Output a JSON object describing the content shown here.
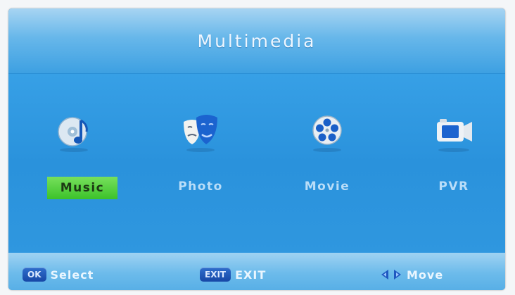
{
  "header": {
    "title": "Multimedia"
  },
  "menu": {
    "items": [
      {
        "label": "Music",
        "icon": "music-disc-icon",
        "selected": true
      },
      {
        "label": "Photo",
        "icon": "photo-masks-icon",
        "selected": false
      },
      {
        "label": "Movie",
        "icon": "movie-reel-icon",
        "selected": false
      },
      {
        "label": "PVR",
        "icon": "pvr-camera-icon",
        "selected": false
      }
    ]
  },
  "footer": {
    "select": {
      "key": "OK",
      "label": "Select"
    },
    "exit": {
      "key": "EXIT",
      "label": "EXIT"
    },
    "move": {
      "label": "Move"
    }
  },
  "colors": {
    "background": "#2f95dd",
    "selected_highlight": "#4fcd37",
    "label_text": "#b9ddf8"
  }
}
